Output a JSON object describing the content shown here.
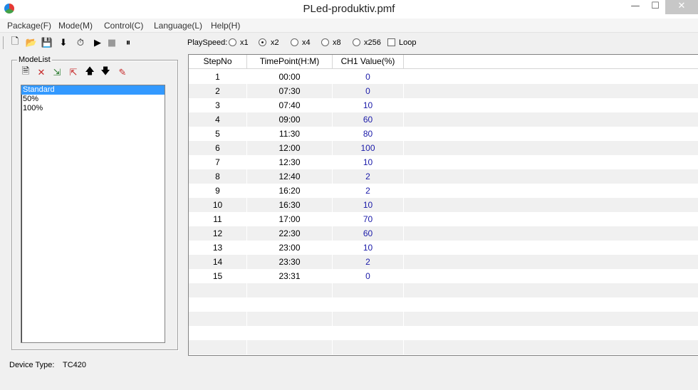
{
  "window": {
    "title": "PLed-produktiv.pmf",
    "min_glyph": "—",
    "max_glyph": "☐",
    "close_glyph": "✕"
  },
  "menu": [
    {
      "label": "Package(F)"
    },
    {
      "label": "Mode(M)"
    },
    {
      "label": "Control(C)"
    },
    {
      "label": "Language(L)"
    },
    {
      "label": "Help(H)"
    }
  ],
  "toolbar": {
    "icons": [
      "new-file-icon",
      "open-folder-icon",
      "save-icon",
      "download-icon",
      "clock-icon",
      "play-icon",
      "stop-icon",
      "pause-icon"
    ],
    "glyphs": [
      "🗋",
      "📂",
      "💾",
      "⬇",
      "⏱",
      "▶",
      "■",
      "⏸"
    ]
  },
  "playspeed": {
    "label": "PlaySpeed:",
    "options": [
      {
        "label": "x1",
        "selected": false
      },
      {
        "label": "x2",
        "selected": true
      },
      {
        "label": "x4",
        "selected": false
      },
      {
        "label": "x8",
        "selected": false
      },
      {
        "label": "x256",
        "selected": false
      }
    ],
    "loop_label": "Loop",
    "loop_checked": false
  },
  "modelist": {
    "title": "ModeList",
    "tool_icons": [
      "new-mode-icon",
      "delete-icon",
      "import-icon",
      "export-icon",
      "move-up-icon",
      "move-down-icon",
      "edit-icon"
    ],
    "tool_glyphs": [
      "🗎",
      "✕",
      "⇲",
      "⇱",
      "🡅",
      "🡇",
      "✎"
    ],
    "items": [
      {
        "label": "Standard",
        "selected": true
      },
      {
        "label": "50%",
        "selected": false
      },
      {
        "label": "100%",
        "selected": false
      }
    ]
  },
  "table": {
    "columns": [
      "StepNo",
      "TimePoint(H:M)",
      "CH1 Value(%)"
    ],
    "rows": [
      {
        "step": "1",
        "time": "00:00",
        "value": "0"
      },
      {
        "step": "2",
        "time": "07:30",
        "value": "0"
      },
      {
        "step": "3",
        "time": "07:40",
        "value": "10"
      },
      {
        "step": "4",
        "time": "09:00",
        "value": "60"
      },
      {
        "step": "5",
        "time": "11:30",
        "value": "80"
      },
      {
        "step": "6",
        "time": "12:00",
        "value": "100"
      },
      {
        "step": "7",
        "time": "12:30",
        "value": "10"
      },
      {
        "step": "8",
        "time": "12:40",
        "value": "2"
      },
      {
        "step": "9",
        "time": "16:20",
        "value": "2"
      },
      {
        "step": "10",
        "time": "16:30",
        "value": "10"
      },
      {
        "step": "11",
        "time": "17:00",
        "value": "70"
      },
      {
        "step": "12",
        "time": "22:30",
        "value": "60"
      },
      {
        "step": "13",
        "time": "23:00",
        "value": "10"
      },
      {
        "step": "14",
        "time": "23:30",
        "value": "2"
      },
      {
        "step": "15",
        "time": "23:31",
        "value": "0"
      }
    ]
  },
  "status": {
    "device_label": "Device Type:",
    "device_value": "TC420"
  },
  "colors": {
    "selection": "#3399ff",
    "value_text": "#1a1aa8",
    "stripe": "#f0f0f0"
  }
}
